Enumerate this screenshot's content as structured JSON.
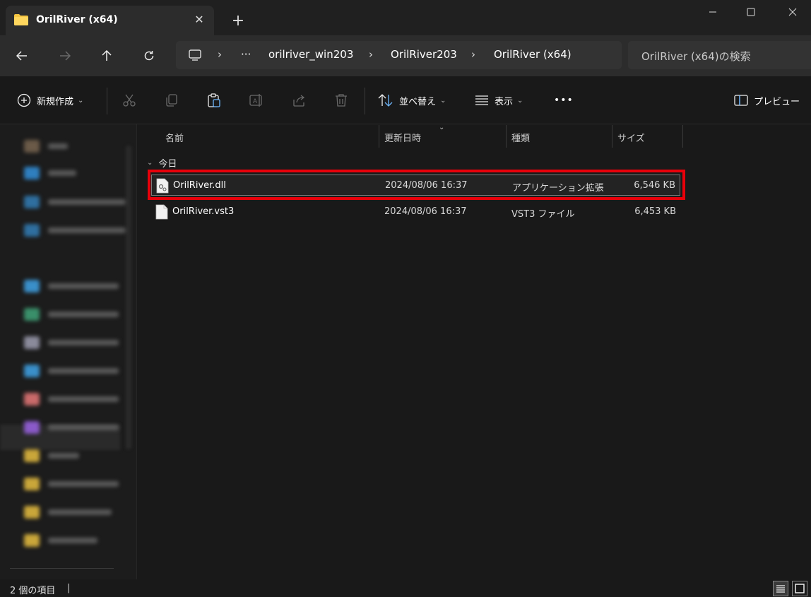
{
  "window": {
    "tab_title": "OrilRiver (x64)",
    "close_tab_glyph": "✕",
    "new_tab_glyph": "+"
  },
  "address": {
    "ellipsis": "···",
    "crumbs": [
      "orilriver_win203",
      "OrilRiver203",
      "OrilRiver (x64)"
    ],
    "search_placeholder": "OrilRiver (x64)の検索"
  },
  "toolbar": {
    "new_label": "新規作成",
    "sort_label": "並べ替え",
    "view_label": "表示",
    "more_glyph": "•••",
    "preview_label": "プレビュー"
  },
  "columns": {
    "name": "名前",
    "date": "更新日時",
    "type": "種類",
    "size": "サイズ"
  },
  "group": {
    "label": "今日"
  },
  "files": [
    {
      "name": "OrilRiver.dll",
      "date": "2024/08/06 16:37",
      "type": "アプリケーション拡張",
      "size": "6,546 KB",
      "selected": true
    },
    {
      "name": "OrilRiver.vst3",
      "date": "2024/08/06 16:37",
      "type": "VST3 ファイル",
      "size": "6,453 KB",
      "selected": false
    }
  ],
  "status": {
    "count": "2 個の項目",
    "sep": "|"
  },
  "colors": {
    "highlight": "#e8000a",
    "folder": "#f5c542",
    "background": "#191919"
  }
}
